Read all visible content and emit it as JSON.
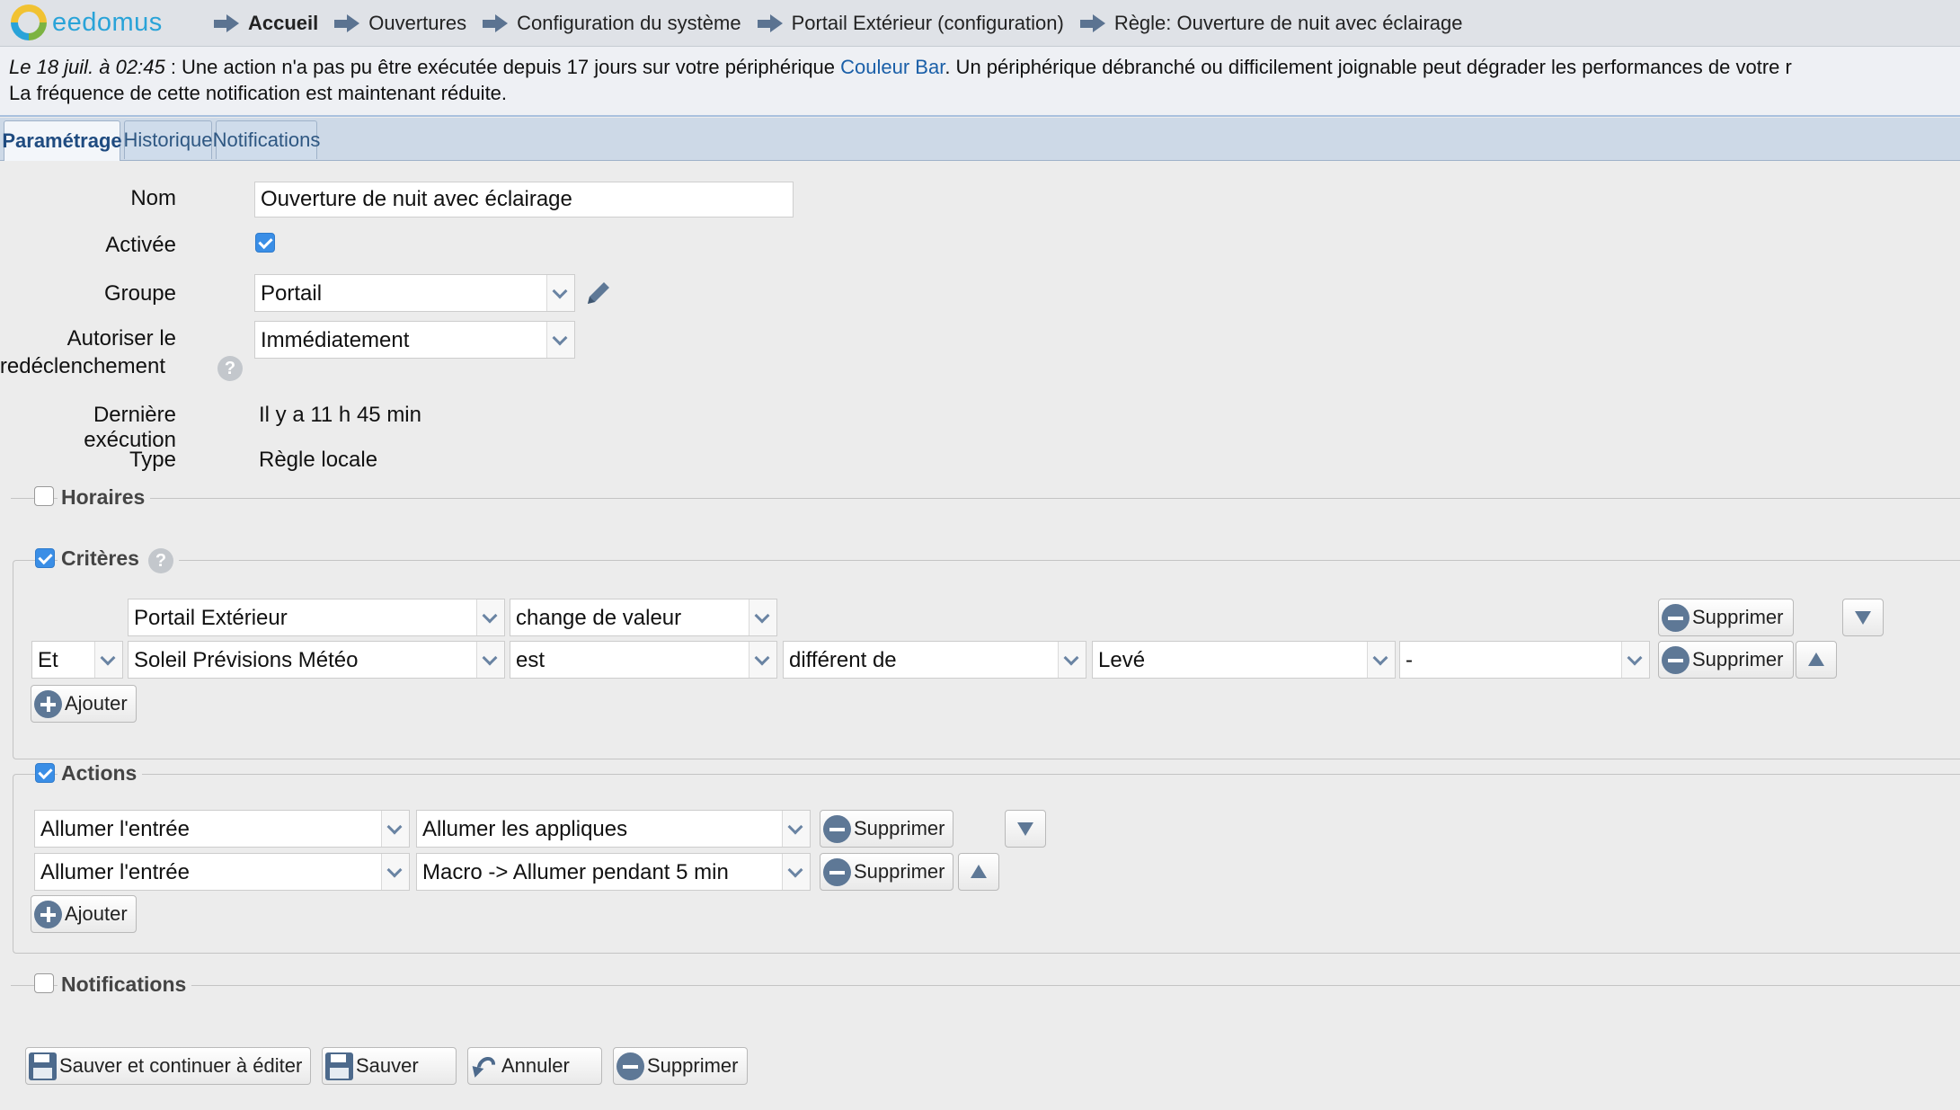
{
  "app": {
    "logo_text": "eedomus"
  },
  "breadcrumb": [
    {
      "label": "Accueil"
    },
    {
      "label": "Ouvertures"
    },
    {
      "label": "Configuration du système"
    },
    {
      "label": "Portail Extérieur (configuration)"
    },
    {
      "label": "Règle: Ouverture de nuit avec éclairage"
    }
  ],
  "notification": {
    "date": "Le 18 juil. à 02:45",
    "before_link": " : Une action n'a pas pu être exécutée depuis 17 jours sur votre périphérique ",
    "link": "Couleur Bar",
    "after_link": ". Un périphérique débranché ou difficilement joignable peut dégrader les performances de votre r",
    "line2": "La fréquence de cette notification est maintenant réduite."
  },
  "tabs": [
    "Paramétrage",
    "Historique",
    "Notifications"
  ],
  "form": {
    "nom_label": "Nom",
    "nom_value": "Ouverture de nuit avec éclairage",
    "activee_label": "Activée",
    "activee_checked": true,
    "groupe_label": "Groupe",
    "groupe_value": "Portail",
    "redecl_label_1": "Autoriser le",
    "redecl_label_2": "redéclenchement",
    "redecl_value": "Immédiatement",
    "derniere_label": "Dernière exécution",
    "derniere_value": "Il y a 11 h 45 min",
    "type_label": "Type",
    "type_value": "Règle locale"
  },
  "sections": {
    "horaires": {
      "title": "Horaires",
      "checked": false
    },
    "criteres": {
      "title": "Critères",
      "checked": true
    },
    "actions": {
      "title": "Actions",
      "checked": true
    },
    "notifications": {
      "title": "Notifications",
      "checked": false
    }
  },
  "criteres": {
    "row1": {
      "device": "Portail Extérieur",
      "condition": "change de valeur"
    },
    "row2": {
      "logic": "Et",
      "device": "Soleil Prévisions Météo",
      "condition": "est",
      "operator": "différent de",
      "value": "Levé",
      "extra": "-"
    }
  },
  "actions": {
    "row1": {
      "action": "Allumer l'entrée",
      "target": "Allumer les appliques"
    },
    "row2": {
      "action": "Allumer l'entrée",
      "target": "Macro -> Allumer pendant 5 min"
    }
  },
  "buttons": {
    "supprimer": "Supprimer",
    "ajouter": "Ajouter",
    "save_continue": "Sauver et continuer à éditer",
    "save": "Sauver",
    "cancel": "Annuler",
    "delete": "Supprimer"
  },
  "help_glyph": "?",
  "colors": {
    "accent": "#3a8ee6",
    "tab_active_text": "#1f4b80",
    "link": "#1a5fa8",
    "icon_blue": "#5e7896"
  }
}
